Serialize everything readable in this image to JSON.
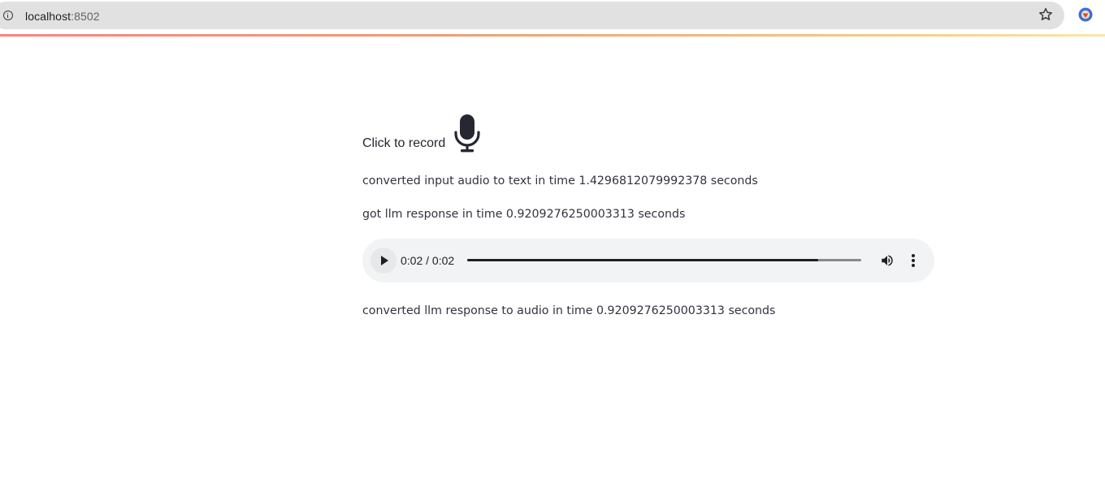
{
  "browser": {
    "url_host": "localhost",
    "url_port": ":8502"
  },
  "recorder": {
    "label": "Click to record"
  },
  "messages": {
    "stt": "converted input audio to text in time 1.4296812079992378 seconds",
    "llm": "got llm response in time 0.9209276250003313 seconds",
    "tts": "converted llm response to audio in time 0.9209276250003313 seconds"
  },
  "audio": {
    "time": "0:02 / 0:02",
    "progress": 0.89
  },
  "colors": {
    "accent_gradient_start": "#ff6b6b",
    "accent_gradient_end": "#fbe39a",
    "player_bg": "#f1f3f4"
  }
}
